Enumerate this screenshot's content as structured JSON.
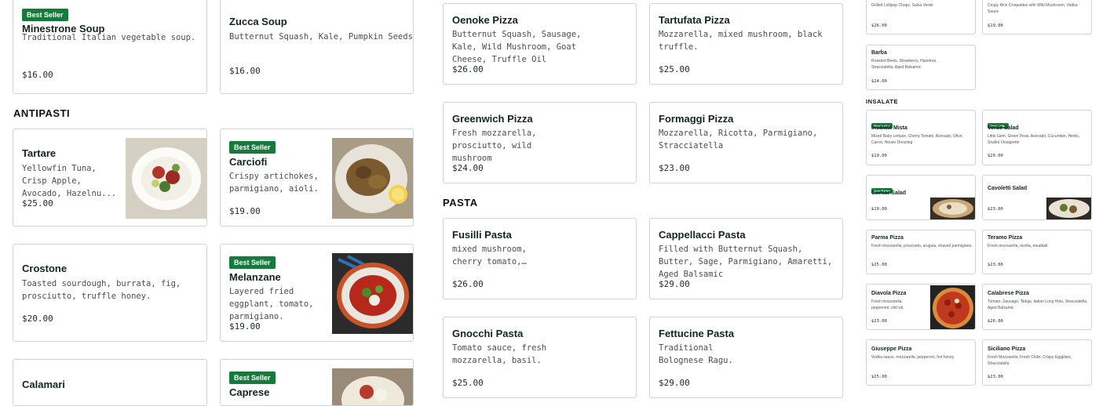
{
  "badge": "Best Seller",
  "sections": {
    "antipasti": "ANTIPASTI",
    "pasta": "PASTA",
    "insalate": "INSALATE"
  },
  "col1": {
    "minestrone": {
      "title": "Minestrone Soup",
      "desc": "Traditional Italian vegetable soup.",
      "price": "$16.00"
    },
    "tartare": {
      "title": "Tartare",
      "desc": "Yellowfin Tuna, Crisp Apple, Avocado, Hazelnu...",
      "price": "$25.00"
    },
    "crostone": {
      "title": "Crostone",
      "desc": "Toasted sourdough, burrata, fig, prosciutto, truffle honey.",
      "price": "$20.00"
    },
    "calamari": {
      "title": "Calamari"
    }
  },
  "col2": {
    "zucca": {
      "title": "Zucca Soup",
      "desc": "Butternut Squash, Kale, Pumpkin Seeds",
      "price": "$16.00"
    },
    "carciofi": {
      "title": "Carciofi",
      "desc": "Crispy artichokes, parmigiano, aioli.",
      "price": "$19.00"
    },
    "melanzane": {
      "title": "Melanzane",
      "desc": "Layered fried eggplant, tomato, parmigiano.",
      "price": "$19.00"
    },
    "caprese": {
      "title": "Caprese"
    }
  },
  "col3": {
    "oenoke": {
      "title": "Oenoke Pizza",
      "desc": "Butternut Squash, Sausage, Kale, Wild Mushroom, Goat Cheese, Truffle Oil",
      "price": "$26.00"
    },
    "greenwich": {
      "title": "Greenwich Pizza",
      "desc": "Fresh mozzarella, prosciutto, wild mushroom",
      "price": "$24.00"
    },
    "fusilli": {
      "title": "Fusilli Pasta",
      "desc": "mixed mushroom, cherry tomato, mascarpone,...",
      "price": "$26.00"
    },
    "gnocchi": {
      "title": "Gnocchi Pasta",
      "desc": "Tomato sauce, fresh mozzarella, basil.",
      "price": "$25.00"
    }
  },
  "col4": {
    "tartufata": {
      "title": "Tartufata Pizza",
      "desc": "Mozzarella, mixed mushroom, black truffle.",
      "price": "$25.00"
    },
    "formaggi": {
      "title": "Formaggi Pizza",
      "desc": "Mozzarella, Ricotta, Parmigiano, Stracciatella",
      "price": "$23.00"
    },
    "cappellacci": {
      "title": "Cappellacci Pasta",
      "desc": "Filled with Butternut Squash, Butter, Sage, Parmigiano, Amaretti, Aged Balsamic",
      "price": "$29.00"
    },
    "fettucine": {
      "title": "Fettucine Pasta",
      "desc": "Traditional Bolognese Ragu.",
      "price": "$29.00"
    }
  },
  "small": {
    "lollipop": {
      "desc": "Grilled Lollipop Chops, Salsa Verde",
      "price": "$26.00"
    },
    "croquettes": {
      "desc": "Crispy Rice Croquettes with Wild Mushroom, Vodka Sauce",
      "price": "$19.00"
    },
    "barba": {
      "title": "Barba",
      "desc": "Roasted Beets, Strawberry, Hazelnut, Stracciatella, Aged Balsamic",
      "price": "$24.00"
    },
    "insalata": {
      "title": "Insalata Mista",
      "desc": "Mixed Baby Lettuce, Cherry Tomato, Avocado, Olive, Carrot, House Dressing",
      "price": "$19.00"
    },
    "verde": {
      "title": "Verde Salad",
      "desc": "Little Gem, Green Peas, Avocado, Cucumber, Herbs, Shallot Vinaigrette",
      "price": "$20.00"
    },
    "caesar": {
      "title": "Caesar Salad",
      "price": "$19.00"
    },
    "cavoletti": {
      "title": "Cavoletti Salad",
      "price": "$23.00"
    },
    "parma": {
      "title": "Parma Pizza",
      "desc": "Fresh mozzarella, prosciutto, arugula, shaved parmigiano.",
      "price": "$25.00"
    },
    "teramo": {
      "title": "Teramo Pizza",
      "desc": "Fresh mozzarella, ricotta, meatball.",
      "price": "$23.00"
    },
    "diavola": {
      "title": "Diavola Pizza",
      "desc": "Fresh mozzarella, pepperoni, chili oil.",
      "price": "$23.00"
    },
    "calabrese": {
      "title": "Calabrese Pizza",
      "desc": "Tomato, Sausage, 'Nduja, Italian Long Hots, Stracciatella, Aged Balsamic",
      "price": "$26.00"
    },
    "giuseppe": {
      "title": "Giuseppe Pizza",
      "desc": "Vodka sauce, mozzarella, pepperoni, hot honey.",
      "price": "$25.00"
    },
    "siciliano": {
      "title": "Siciliano Pizza",
      "desc": "Fresh Mozzarella, Fresh Chilis, Crispy Eggplant, Stracciatella",
      "price": "$23.00"
    }
  },
  "colors": {
    "badge": "#157a3c",
    "border": "#cfd3d1"
  },
  "icons": [
    "tartare-photo",
    "carciofi-photo",
    "melanzane-photo",
    "caprese-photo",
    "caesar-photo",
    "cavoletti-photo",
    "diavola-photo"
  ]
}
